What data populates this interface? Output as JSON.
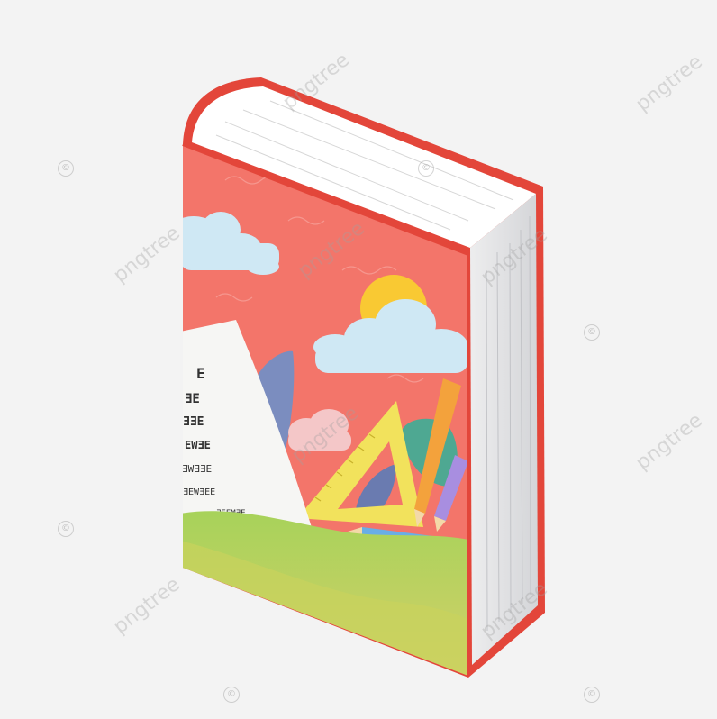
{
  "watermark": {
    "text": "pngtree",
    "copyright_glyph": "©"
  },
  "scene": {
    "subject": "book-illustration",
    "colors": {
      "cover": "#f3756a",
      "spine_edge": "#e3463a",
      "pages": "#e9e9ea",
      "page_top": "#ffffff",
      "grass": "#9ccc52",
      "sky_cloud": "#cfe8f4",
      "sun": "#f9c933",
      "ruler": "#f2e25c",
      "pencil_orange": "#f3a23c",
      "pencil_blue": "#69aee6",
      "pencil_purple": "#a88ee0",
      "leaf": "#7b8dbf"
    }
  },
  "eye_chart": {
    "rows": [
      "E",
      "ƎE",
      "ƎƎE",
      "EWƎE",
      "ƎWƎƎE",
      "ƎEWƎEE",
      "ƎEEMƎE"
    ]
  }
}
